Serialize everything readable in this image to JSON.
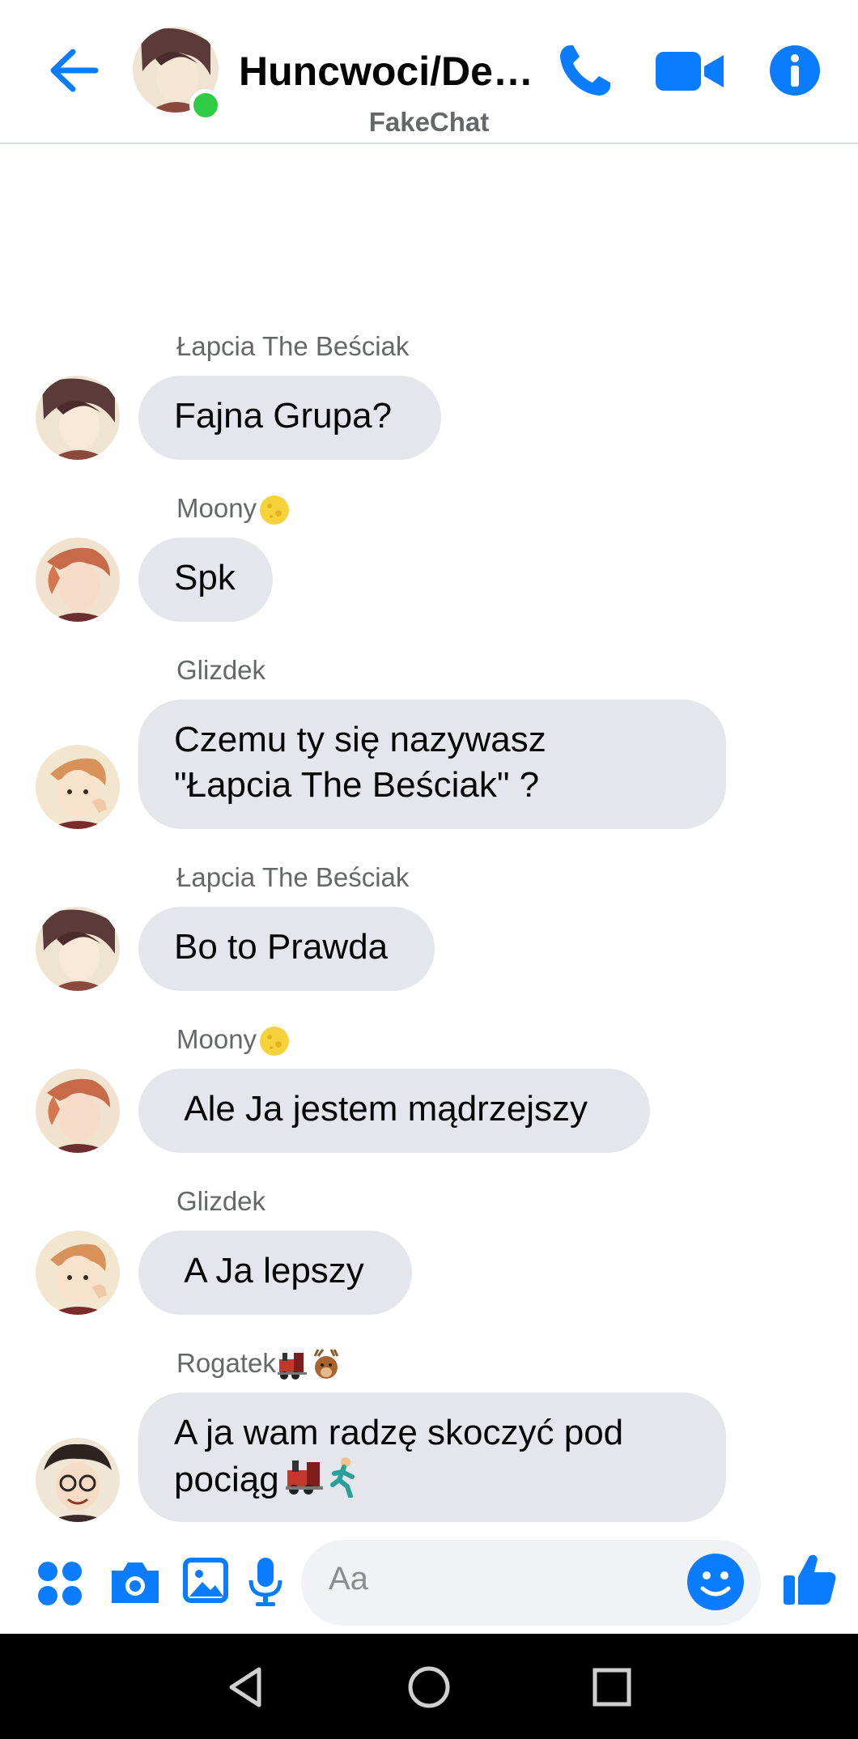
{
  "header": {
    "title": "Huncwoci/Deb…",
    "subtitle": "FakeChat",
    "icons": [
      "back-arrow-icon",
      "phone-icon",
      "video-camera-icon",
      "info-icon"
    ],
    "accent_color": "#0a7cff",
    "online_color": "#31cc46"
  },
  "messages": [
    {
      "sender": "Łapcia The Beściak",
      "sender_emoji": "",
      "text": "Fajna Grupa?",
      "avatar": "avatar-lapcia"
    },
    {
      "sender": "Moony",
      "sender_emoji": "full-moon-emoji",
      "text": "Spk",
      "avatar": "avatar-moony"
    },
    {
      "sender": "Glizdek",
      "sender_emoji": "",
      "text": "Czemu ty się nazywasz\n\"Łapcia The Beściak\" ?",
      "avatar": "avatar-glizdek"
    },
    {
      "sender": "Łapcia The Beściak",
      "sender_emoji": "",
      "text": "Bo to Prawda",
      "avatar": "avatar-lapcia"
    },
    {
      "sender": "Moony",
      "sender_emoji": "full-moon-emoji",
      "text": " Ale Ja jestem mądrzejszy",
      "avatar": "avatar-moony"
    },
    {
      "sender": "Glizdek",
      "sender_emoji": "",
      "text": " A Ja lepszy",
      "avatar": "avatar-glizdek"
    },
    {
      "sender": "Rogatek",
      "sender_emoji": "locomotive-and-deer-emoji",
      "text": "A ja wam radzę skoczyć pod\npociąg",
      "text_emoji": "locomotive-and-runner-emoji",
      "avatar": "avatar-rogatek"
    }
  ],
  "composer": {
    "placeholder": "Aa",
    "icons": [
      "apps-grid-icon",
      "camera-icon",
      "gallery-icon",
      "microphone-icon",
      "emoji-icon",
      "thumbs-up-icon"
    ]
  },
  "system_nav": {
    "icons": [
      "back-triangle-icon",
      "home-circle-icon",
      "recents-square-icon"
    ]
  },
  "colors": {
    "bubble_bg": "#e4e6eb",
    "sender_text": "#65676b",
    "input_bg": "#f0f2f5"
  }
}
